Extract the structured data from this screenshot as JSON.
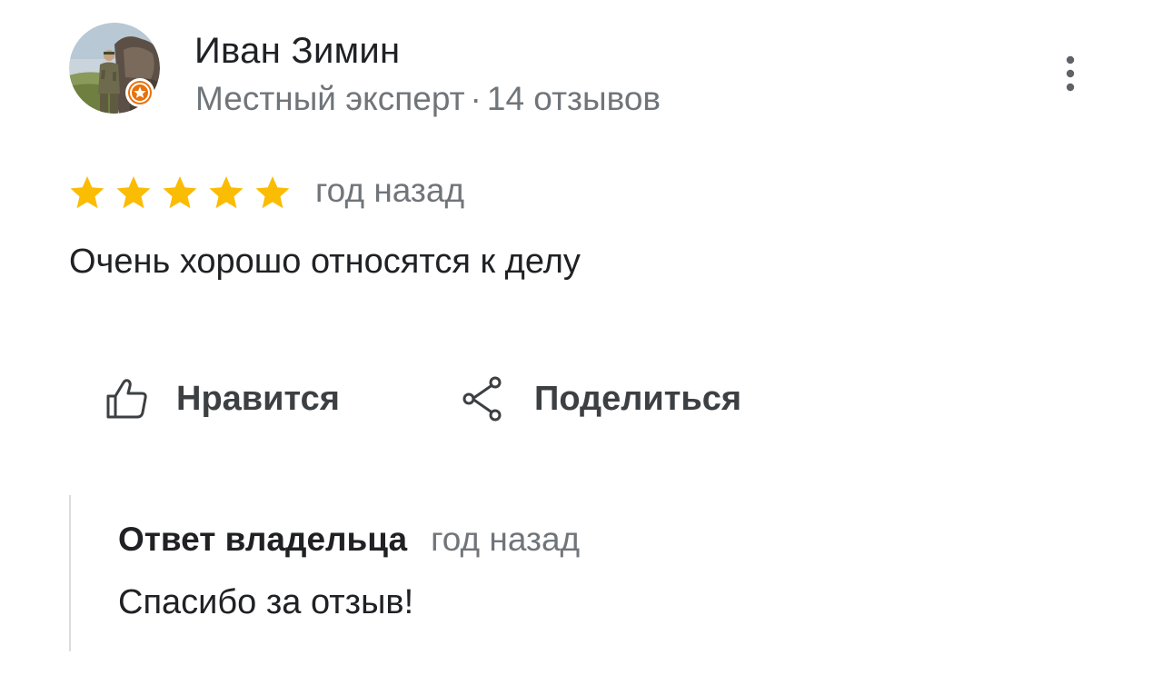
{
  "author": {
    "name": "Иван Зимин",
    "meta_level": "Местный эксперт",
    "meta_separator": "·",
    "meta_reviews": "14 отзывов",
    "avatar_icon": "user-photo-avatar",
    "badge_icon": "local-guide-star-badge"
  },
  "menu": {
    "icon": "more-vert-icon"
  },
  "review": {
    "rating": 5,
    "rating_max": 5,
    "star_color": "#fbbc04",
    "date": "год назад",
    "text": "Очень хорошо относятся к делу"
  },
  "actions": {
    "like_label": "Нравится",
    "like_icon": "thumb-up-outline-icon",
    "share_label": "Поделиться",
    "share_icon": "share-icon"
  },
  "owner_reply": {
    "title": "Ответ владельца",
    "date": "год назад",
    "text": "Спасибо за отзыв!"
  },
  "colors": {
    "primary_text": "#202124",
    "secondary_text": "#70757a",
    "badge_orange": "#e8710a"
  }
}
